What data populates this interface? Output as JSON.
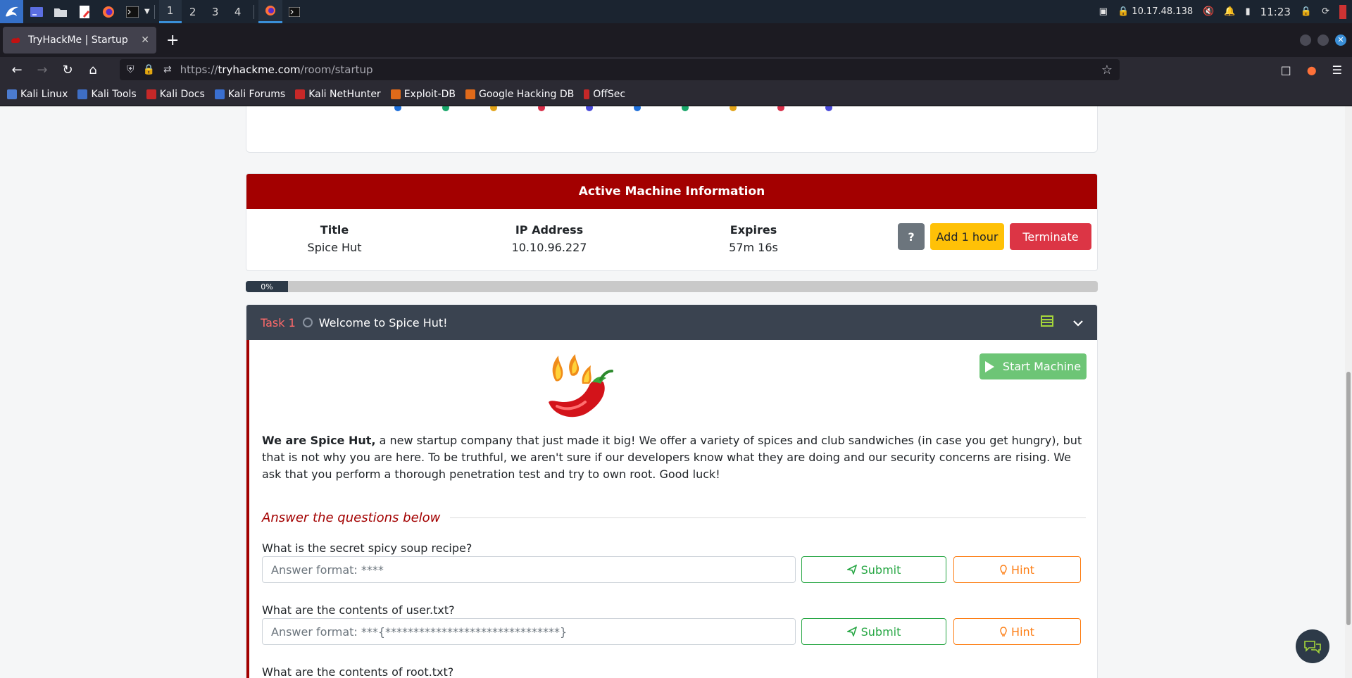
{
  "taskbar": {
    "workspaces": [
      "1",
      "2",
      "3",
      "4"
    ],
    "ip": "10.17.48.138",
    "time": "11:23"
  },
  "browser": {
    "tab_title": "TryHackMe | Startup",
    "url_prefix": "https://",
    "url_domain": "tryhackme.com",
    "url_path": "/room/startup",
    "bookmarks": [
      "Kali Linux",
      "Kali Tools",
      "Kali Docs",
      "Kali Forums",
      "Kali NetHunter",
      "Exploit-DB",
      "Google Hacking DB",
      "OffSec"
    ]
  },
  "machine": {
    "header": "Active Machine Information",
    "title_label": "Title",
    "title_value": "Spice Hut",
    "ip_label": "IP Address",
    "ip_value": "10.10.96.227",
    "expires_label": "Expires",
    "expires_value": "57m 16s",
    "help_label": "?",
    "add_hour_label": "Add 1 hour",
    "terminate_label": "Terminate"
  },
  "progress": {
    "label": "0%",
    "percent": 0
  },
  "task": {
    "number": "Task 1",
    "title": "Welcome to Spice Hut!",
    "start_machine_label": "Start Machine",
    "intro_bold": "We are Spice Hut,",
    "intro_text": " a new startup company that just made it big! We offer a variety of spices and club sandwiches (in case you get hungry), but that is not why you are here. To be truthful, we aren't sure if our developers know what they are doing and our security concerns are rising. We ask that you perform a thorough penetration test and try to own root. Good luck!",
    "answer_heading": "Answer the questions below",
    "questions": [
      {
        "text": "What is the secret spicy soup recipe?",
        "placeholder": "Answer format: ****",
        "submit": "Submit",
        "hint": "Hint"
      },
      {
        "text": "What are the contents of user.txt?",
        "placeholder": "Answer format: ***{*******************************}",
        "submit": "Submit",
        "hint": "Hint"
      },
      {
        "text": "What are the contents of root.txt?"
      }
    ]
  },
  "colors": {
    "brand_red": "#a30000",
    "task_header": "#3a4350",
    "success": "#28a745",
    "warning": "#ffc107",
    "danger": "#dc3545",
    "hint_orange": "#fd7e14"
  }
}
